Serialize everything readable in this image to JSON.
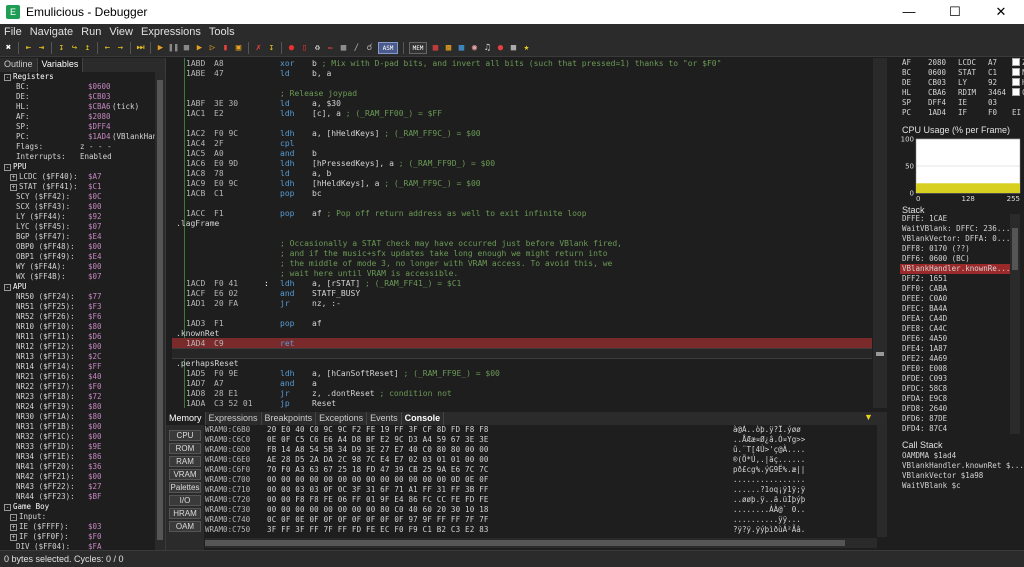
{
  "window": {
    "title": "Emulicious - Debugger"
  },
  "menu": [
    "File",
    "Navigate",
    "Run",
    "View",
    "Expressions",
    "Tools"
  ],
  "toolbar": {
    "asm_label": "ASM",
    "mem_label": "MEM"
  },
  "left_tabs": [
    "Outline",
    "Variables"
  ],
  "variables": [
    {
      "indent": 0,
      "exp": "-",
      "name": "Registers",
      "value": "",
      "extra": ""
    },
    {
      "indent": 2,
      "exp": "",
      "name": "BC:",
      "value": "$0600",
      "extra": ""
    },
    {
      "indent": 2,
      "exp": "",
      "name": "DE:",
      "value": "$CB03",
      "extra": ""
    },
    {
      "indent": 2,
      "exp": "",
      "name": "HL:",
      "value": "$CBA6",
      "extra": "(tick)"
    },
    {
      "indent": 2,
      "exp": "",
      "name": "AF:",
      "value": "$2080",
      "extra": ""
    },
    {
      "indent": 2,
      "exp": "",
      "name": "SP:",
      "value": "$DFF4",
      "extra": ""
    },
    {
      "indent": 2,
      "exp": "",
      "name": "PC:",
      "value": "$1AD4",
      "extra": "(VBlankHandler.k"
    },
    {
      "indent": 2,
      "exp": "",
      "name": "Flags:",
      "value": "",
      "extra": "z - - -"
    },
    {
      "indent": 2,
      "exp": "",
      "name": "Interrupts:",
      "value": "",
      "extra": "Enabled"
    },
    {
      "indent": 0,
      "exp": "-",
      "name": "PPU",
      "value": "",
      "extra": ""
    },
    {
      "indent": 1,
      "exp": "+",
      "name": "LCDC ($FF40):",
      "value": "$A7",
      "extra": ""
    },
    {
      "indent": 1,
      "exp": "+",
      "name": "STAT ($FF41):",
      "value": "$C1",
      "extra": ""
    },
    {
      "indent": 2,
      "exp": "",
      "name": "SCY ($FF42):",
      "value": "$0C",
      "extra": ""
    },
    {
      "indent": 2,
      "exp": "",
      "name": "SCX ($FF43):",
      "value": "$00",
      "extra": ""
    },
    {
      "indent": 2,
      "exp": "",
      "name": "LY ($FF44):",
      "value": "$92",
      "extra": ""
    },
    {
      "indent": 2,
      "exp": "",
      "name": "LYC ($FF45):",
      "value": "$07",
      "extra": ""
    },
    {
      "indent": 2,
      "exp": "",
      "name": "BGP ($FF47):",
      "value": "$E4",
      "extra": ""
    },
    {
      "indent": 2,
      "exp": "",
      "name": "OBP0 ($FF48):",
      "value": "$00",
      "extra": ""
    },
    {
      "indent": 2,
      "exp": "",
      "name": "OBP1 ($FF49):",
      "value": "$E4",
      "extra": ""
    },
    {
      "indent": 2,
      "exp": "",
      "name": "WY ($FF4A):",
      "value": "$00",
      "extra": ""
    },
    {
      "indent": 2,
      "exp": "",
      "name": "WX ($FF4B):",
      "value": "$07",
      "extra": ""
    },
    {
      "indent": 0,
      "exp": "-",
      "name": "APU",
      "value": "",
      "extra": ""
    },
    {
      "indent": 2,
      "exp": "",
      "name": "NR50 ($FF24):",
      "value": "$77",
      "extra": ""
    },
    {
      "indent": 2,
      "exp": "",
      "name": "NR51 ($FF25):",
      "value": "$F3",
      "extra": ""
    },
    {
      "indent": 2,
      "exp": "",
      "name": "NR52 ($FF26):",
      "value": "$F6",
      "extra": ""
    },
    {
      "indent": 2,
      "exp": "",
      "name": "NR10 ($FF10):",
      "value": "$80",
      "extra": ""
    },
    {
      "indent": 2,
      "exp": "",
      "name": "NR11 ($FF11):",
      "value": "$D6",
      "extra": ""
    },
    {
      "indent": 2,
      "exp": "",
      "name": "NR12 ($FF12):",
      "value": "$00",
      "extra": ""
    },
    {
      "indent": 2,
      "exp": "",
      "name": "NR13 ($FF13):",
      "value": "$2C",
      "extra": ""
    },
    {
      "indent": 2,
      "exp": "",
      "name": "NR14 ($FF14):",
      "value": "$FF",
      "extra": ""
    },
    {
      "indent": 2,
      "exp": "",
      "name": "NR21 ($FF16):",
      "value": "$40",
      "extra": ""
    },
    {
      "indent": 2,
      "exp": "",
      "name": "NR22 ($FF17):",
      "value": "$F0",
      "extra": ""
    },
    {
      "indent": 2,
      "exp": "",
      "name": "NR23 ($FF18):",
      "value": "$72",
      "extra": ""
    },
    {
      "indent": 2,
      "exp": "",
      "name": "NR24 ($FF19):",
      "value": "$80",
      "extra": ""
    },
    {
      "indent": 2,
      "exp": "",
      "name": "NR30 ($FF1A):",
      "value": "$80",
      "extra": ""
    },
    {
      "indent": 2,
      "exp": "",
      "name": "NR31 ($FF1B):",
      "value": "$00",
      "extra": ""
    },
    {
      "indent": 2,
      "exp": "",
      "name": "NR32 ($FF1C):",
      "value": "$00",
      "extra": ""
    },
    {
      "indent": 2,
      "exp": "",
      "name": "NR33 ($FF1D):",
      "value": "$9E",
      "extra": ""
    },
    {
      "indent": 2,
      "exp": "",
      "name": "NR34 ($FF1E):",
      "value": "$86",
      "extra": ""
    },
    {
      "indent": 2,
      "exp": "",
      "name": "NR41 ($FF20):",
      "value": "$36",
      "extra": ""
    },
    {
      "indent": 2,
      "exp": "",
      "name": "NR42 ($FF21):",
      "value": "$00",
      "extra": ""
    },
    {
      "indent": 2,
      "exp": "",
      "name": "NR43 ($FF22):",
      "value": "$27",
      "extra": ""
    },
    {
      "indent": 2,
      "exp": "",
      "name": "NR44 ($FF23):",
      "value": "$BF",
      "extra": ""
    },
    {
      "indent": 0,
      "exp": "-",
      "name": "Game Boy",
      "value": "",
      "extra": ""
    },
    {
      "indent": 1,
      "exp": "-",
      "name": "Input:",
      "value": "",
      "extra": ""
    },
    {
      "indent": 1,
      "exp": "+",
      "name": "IE ($FFFF):",
      "value": "$03",
      "extra": ""
    },
    {
      "indent": 1,
      "exp": "+",
      "name": "IF ($FF0F):",
      "value": "$F0",
      "extra": ""
    },
    {
      "indent": 2,
      "exp": "",
      "name": "DIV ($FF04):",
      "value": "$FA",
      "extra": ""
    }
  ],
  "code": [
    {
      "kind": "ins",
      "addr": "1ABD",
      "bytes": "A8",
      "mn": "xor",
      "op": "b",
      "cm": "; Mix with D-pad bits, and invert all bits (such that pressed=1) thanks to \"or $F0\""
    },
    {
      "kind": "ins",
      "addr": "1ABE",
      "bytes": "47",
      "mn": "ld",
      "op": "b, a",
      "cm": ""
    },
    {
      "kind": "blank"
    },
    {
      "kind": "comment",
      "text": "; Release joypad"
    },
    {
      "kind": "ins",
      "addr": "1ABF",
      "bytes": "3E 30",
      "mn": "ld",
      "op": "a, $30",
      "cm": ""
    },
    {
      "kind": "ins",
      "addr": "1AC1",
      "bytes": "E2",
      "mn": "ldh",
      "op": "[c], a",
      "cm": "; (_RAM_FF00_) = $FF"
    },
    {
      "kind": "blank"
    },
    {
      "kind": "ins",
      "addr": "1AC2",
      "bytes": "F0 9C",
      "mn": "ldh",
      "op": "a, [hHeldKeys]",
      "cm": "; (_RAM_FF9C_) = $00"
    },
    {
      "kind": "ins",
      "addr": "1AC4",
      "bytes": "2F",
      "mn": "cpl",
      "op": "",
      "cm": ""
    },
    {
      "kind": "ins",
      "addr": "1AC5",
      "bytes": "A0",
      "mn": "and",
      "op": "b",
      "cm": ""
    },
    {
      "kind": "ins",
      "addr": "1AC6",
      "bytes": "E0 9D",
      "mn": "ldh",
      "op": "[hPressedKeys], a",
      "cm": "; (_RAM_FF9D_) = $00"
    },
    {
      "kind": "ins",
      "addr": "1AC8",
      "bytes": "78",
      "mn": "ld",
      "op": "a, b",
      "cm": ""
    },
    {
      "kind": "ins",
      "addr": "1AC9",
      "bytes": "E0 9C",
      "mn": "ldh",
      "op": "[hHeldKeys], a",
      "cm": "; (_RAM_FF9C_) = $00"
    },
    {
      "kind": "ins",
      "addr": "1ACB",
      "bytes": "C1",
      "mn": "pop",
      "op": "bc",
      "cm": ""
    },
    {
      "kind": "blank"
    },
    {
      "kind": "ins",
      "addr": "1ACC",
      "bytes": "F1",
      "mn": "pop",
      "op": "af",
      "cm": "; Pop off return address as well to exit infinite loop"
    },
    {
      "kind": "label",
      "text": ".lagFrame"
    },
    {
      "kind": "blank"
    },
    {
      "kind": "comment",
      "text": "; Occasionally a STAT check may have occurred just before VBlank fired,"
    },
    {
      "kind": "comment",
      "text": ";  and if the music+sfx updates take long enough we might return into"
    },
    {
      "kind": "comment",
      "text": ";  the middle of mode 3, no longer with VRAM access. To avoid this, we"
    },
    {
      "kind": "comment",
      "text": ";  wait here until VRAM is accessible."
    },
    {
      "kind": "ins",
      "addr": "1ACD",
      "bytes": "F0 41",
      "mn": "ldh",
      "op": "a, [rSTAT]",
      "cm": "; (_RAM_FF41_) = $C1",
      "colon": ":"
    },
    {
      "kind": "ins",
      "addr": "1ACF",
      "bytes": "E6 02",
      "mn": "and",
      "op": "STATF_BUSY",
      "cm": ""
    },
    {
      "kind": "ins",
      "addr": "1AD1",
      "bytes": "20 FA",
      "mn": "jr",
      "op": "nz, :-",
      "cm": ""
    },
    {
      "kind": "blank"
    },
    {
      "kind": "ins",
      "addr": "1AD3",
      "bytes": "F1",
      "mn": "pop",
      "op": "af",
      "cm": ""
    },
    {
      "kind": "label",
      "text": ".knownRet"
    },
    {
      "kind": "ins",
      "addr": "1AD4",
      "bytes": "C9",
      "mn": "ret",
      "op": "",
      "cm": "",
      "hl": true
    },
    {
      "kind": "blank",
      "cur": true
    },
    {
      "kind": "label",
      "text": ".perhapsReset"
    },
    {
      "kind": "ins",
      "addr": "1AD5",
      "bytes": "F0 9E",
      "mn": "ldh",
      "op": "a, [hCanSoftReset]",
      "cm": "; (_RAM_FF9E_) = $00"
    },
    {
      "kind": "ins",
      "addr": "1AD7",
      "bytes": "A7",
      "mn": "and",
      "op": "a",
      "cm": ""
    },
    {
      "kind": "ins",
      "addr": "1AD8",
      "bytes": "28 E1",
      "mn": "jr",
      "op": "z, .dontReset",
      "cm": "; condition not"
    },
    {
      "kind": "ins",
      "addr": "1ADA",
      "bytes": "C3 52 01",
      "mn": "jp",
      "op": "Reset",
      "cm": ""
    }
  ],
  "bottom_tabs": [
    "Memory",
    "Expressions",
    "Breakpoints",
    "Exceptions",
    "Events",
    "Console"
  ],
  "mem_buttons": [
    "CPU",
    "ROM",
    "RAM",
    "VRAM",
    "Palettes",
    "I/O",
    "HRAM",
    "OAM"
  ],
  "memory": [
    {
      "addr": "WRAM0:C6B0",
      "hex": "20 E0 40 C0 9C 9C F2 FE 19 FF 3F CF 8D FD F8 F8",
      "ascii": " à@À..òþ.ÿ?Ï.ýøø"
    },
    {
      "addr": "WRAM0:C6C0",
      "hex": "0E 0F C5 C6 E6 A4 D8 BF E2 9C D3 A4 59 67 3E 3E",
      "ascii": "..ÅÆæ¤Ø¿â.Ó¤Yg>>"
    },
    {
      "addr": "WRAM0:C6D0",
      "hex": "FB 14 A8 54 5B 34 D9 3E 27 E7 40 C0 80 80 00 00",
      "ascii": "û.¨T[4Ù>'ç@À...."
    },
    {
      "addr": "WRAM0:C6E0",
      "hex": "AE 28 D5 2A DA 2C 98 7C E4 E7 02 03 01 01 00 00",
      "ascii": "®(Õ*Ú,.|äç......"
    },
    {
      "addr": "WRAM0:C6F0",
      "hex": "70 F0 A3 63 67 25 18 FD 47 39 CB 25 9A E6 7C 7C",
      "ascii": "pð£cg%.ýG9Ë%.æ||"
    },
    {
      "addr": "WRAM0:C700",
      "hex": "00 00 00 00 00 00 00 00 00 00 00 00 00 0D 0E 0F",
      "ascii": "................"
    },
    {
      "addr": "WRAM0:C710",
      "hex": "00 00 03 03 0F 0C 3F 31 6F 71 A1 FF 31 FF 3B FF",
      "ascii": "......?1oq¡ÿ1ÿ;ÿ"
    },
    {
      "addr": "WRAM0:C720",
      "hex": "00 00 F8 F8 FE 06 FF 01 9F E4 86 FC CC FE FD FE",
      "ascii": "..øøþ.ÿ..ä.üÌþýþ"
    },
    {
      "addr": "WRAM0:C730",
      "hex": "00 00 00 00 00 00 00 00 80 C0 40 60 20 30 10 18",
      "ascii": "........ÀÀ@` 0.."
    },
    {
      "addr": "WRAM0:C740",
      "hex": "0C 0F 0E 0F 0F 0F 0F 0F 0F 0F 97 9F FF FF 7F 7F",
      "ascii": "..........ÿÿ..."
    },
    {
      "addr": "WRAM0:C750",
      "hex": "3F FF 3F FF 7F FF FD FE EC F0 F9 C1 B2 C3 E2 83",
      "ascii": "?ÿ?ÿ.ÿýþìðùÁ²Ãâ."
    }
  ],
  "registers": [
    [
      "AF",
      "2080",
      "LCDC",
      "A7"
    ],
    [
      "BC",
      "0600",
      "STAT",
      "C1"
    ],
    [
      "DE",
      "CB03",
      "LY",
      "92"
    ],
    [
      "HL",
      "CBA6",
      "RDIM",
      "3464"
    ],
    [
      "SP",
      "DFF4",
      "IE",
      "03"
    ],
    [
      "PC",
      "1AD4",
      "IF",
      "F0"
    ]
  ],
  "reg_flags": [
    "Z",
    "N",
    "H",
    "C"
  ],
  "reg_extra": "EI",
  "cpu_usage": {
    "title": "CPU Usage (% per Frame)",
    "chart_data": {
      "type": "area",
      "y_ticks": [
        "100",
        "50",
        "0"
      ],
      "x_ticks": [
        "0",
        "128",
        "255"
      ],
      "ylim": [
        0,
        100
      ],
      "xlim": [
        0,
        255
      ],
      "values": [
        18
      ]
    }
  },
  "stack": {
    "title": "Stack",
    "items": [
      "DFFE: 1CAE",
      "WaitVBlank: DFFC: 236...",
      "VBlankVector: DFFA: 0...",
      "DFF8: 0170  (??)",
      "DFF6: 0600  (BC)",
      "VBlankHandler.knownRe...",
      "DFF2: 1651",
      "DFF0: CABA",
      "DFEE: C0A0",
      "DFEC: BA4A",
      "DFEA: CA4D",
      "DFE8: CA4C",
      "DFE6: 4A50",
      "DFE4: 1A87",
      "DFE2: 4A69",
      "DFE0: E008",
      "DFDE: C093",
      "DFDC: 58C8",
      "DFDA: E9C8",
      "DFD8: 2640",
      "DFD6: 87DE",
      "DFD4: 87C4"
    ],
    "selected_index": 5
  },
  "callstack": {
    "title": "Call Stack",
    "items": [
      "OAMDMA $1ad4",
      "VBlankHandler.knownRet $...",
      "VBlankVector $1a98",
      "WaitVBlank $c"
    ]
  },
  "status": "0 bytes selected. Cycles: 0 / 0",
  "colors": {
    "highlight_row": "#7a2a2a",
    "selected_stack": "#9a2a2a",
    "cpu_bar": "#d8d020",
    "value_purple": "#c586c0"
  }
}
